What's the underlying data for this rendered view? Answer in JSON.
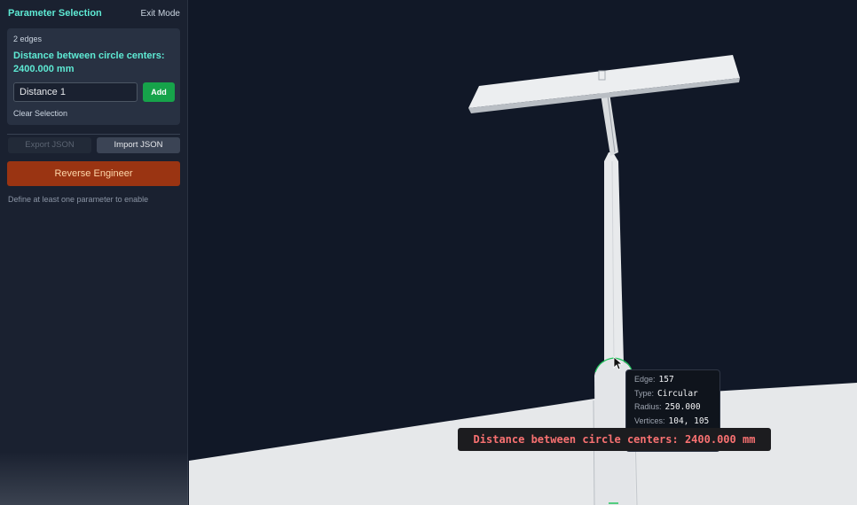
{
  "sidebar": {
    "title": "Parameter Selection",
    "exit_label": "Exit Mode",
    "selection": {
      "edge_count": "2 edges",
      "measurement": "Distance between circle centers: 2400.000 mm",
      "name_value": "Distance 1",
      "add_label": "Add",
      "clear_label": "Clear Selection"
    },
    "export_label": "Export JSON",
    "import_label": "Import JSON",
    "reverse_label": "Reverse Engineer",
    "hint": "Define at least one parameter to enable"
  },
  "tooltip": {
    "edge_key": "Edge:",
    "edge_val": "157",
    "type_key": "Type:",
    "type_val": "Circular",
    "radius_key": "Radius:",
    "radius_val": "250.000",
    "vertices_key": "Vertices:",
    "vertices_val": "104, 105"
  },
  "distance_label": "Distance between circle centers: 2400.000 mm",
  "colors": {
    "accent": "#5eead4",
    "add_button": "#16a34a",
    "reverse_button": "#9a3412",
    "viewport_bg": "#111827",
    "model": "#e5e7eb",
    "measure_text": "#f87171",
    "selection_highlight": "#22c55e"
  },
  "icons": {
    "cursor": "mouse-pointer-icon"
  }
}
